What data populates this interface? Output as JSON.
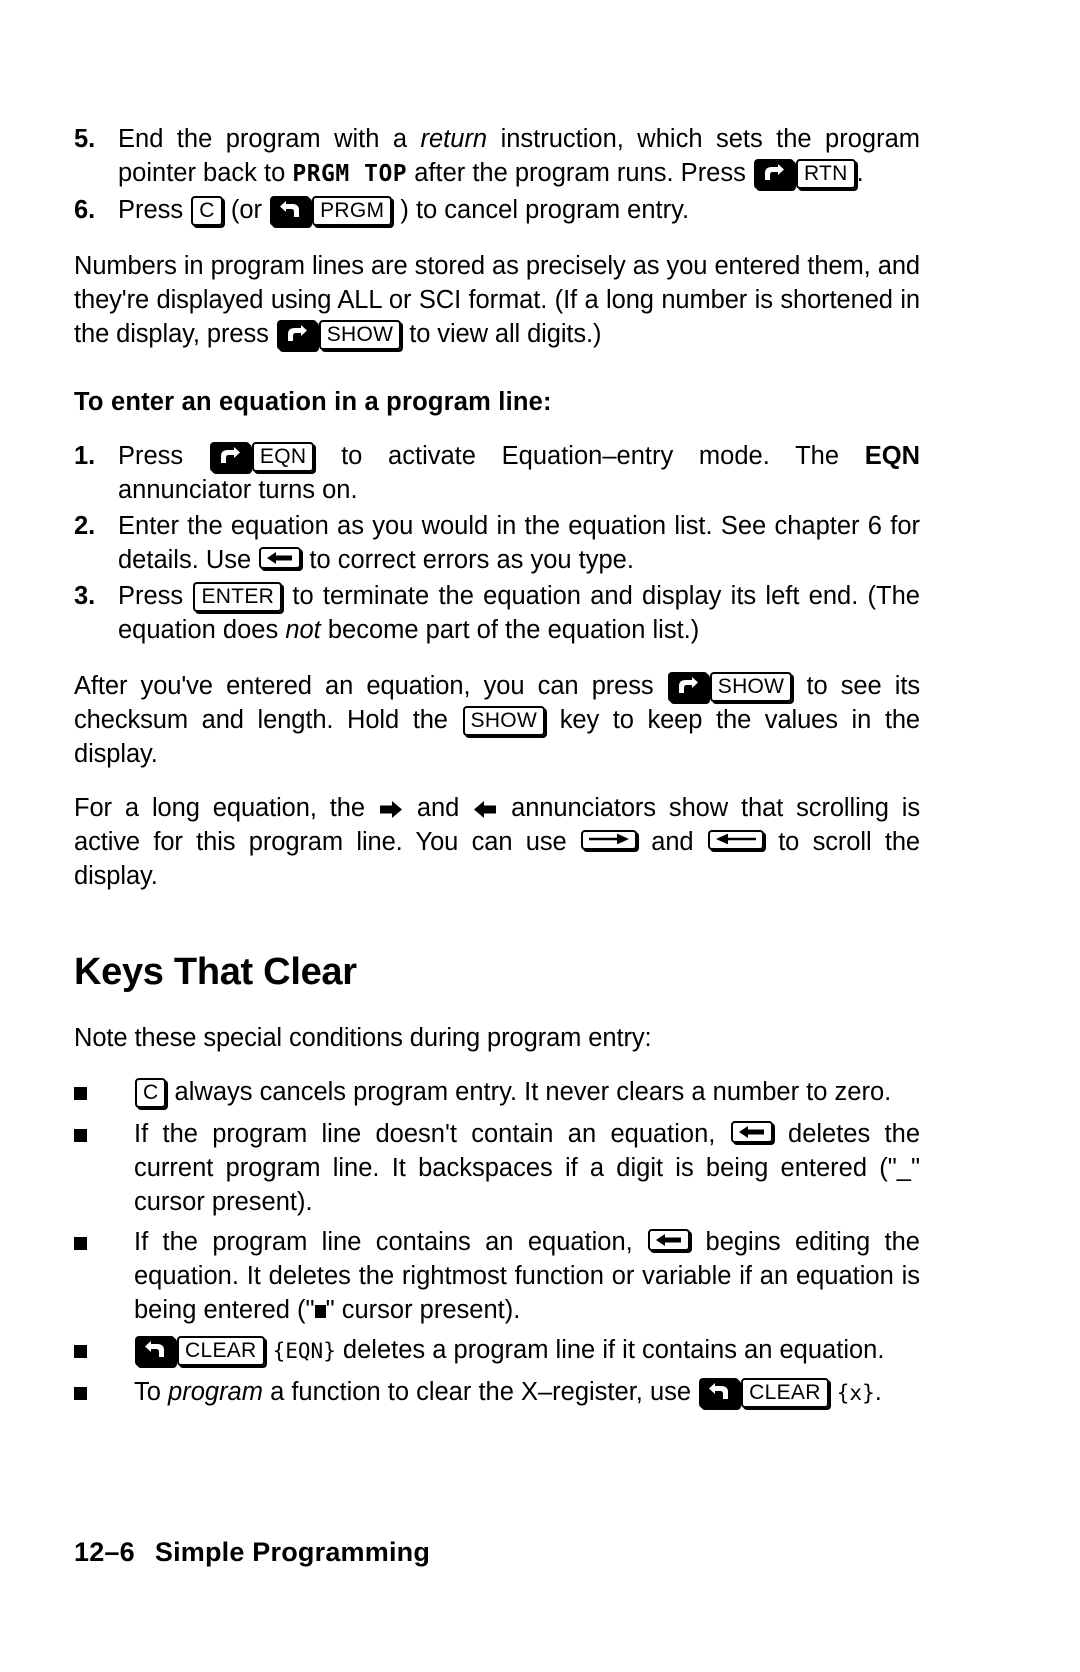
{
  "page": {
    "footer_page_number": "12–6",
    "footer_title": "Simple Programming"
  },
  "steps_continued": [
    {
      "number": "5.",
      "text_1": "End the program with a ",
      "italic_1": "return",
      "text_2": " instruction, which sets the program pointer back to ",
      "lcd_1": "PRGM TOP",
      "text_3": " after the program runs. Press ",
      "key_shift_right": "right-shift",
      "key_1": "RTN",
      "text_4": "."
    },
    {
      "number": "6.",
      "text_1": "Press ",
      "key_1": "C",
      "text_2": " (or ",
      "key_shift_left": "left-shift",
      "key_2": "PRGM",
      "text_3": " ) to cancel program entry."
    }
  ],
  "paragraph_numbers": {
    "text_1": "Numbers in program lines are stored as precisely as you entered them, and they're displayed using ALL or SCI format. (If a long number is shortened in the display, press ",
    "key_shift_right": "right-shift",
    "key_1": "SHOW",
    "text_2": " to view all digits.)"
  },
  "subheading": {
    "label": "To enter an equation in a program line:"
  },
  "equation_steps": [
    {
      "number": "1.",
      "text_1": "Press ",
      "key_shift_right": "right-shift",
      "key_1": "EQN",
      "text_2": " to activate Equation–entry mode. The ",
      "bold_1": "EQN",
      "text_3": " annunciator turns on."
    },
    {
      "number": "2.",
      "text_1": "Enter the equation as you would in the equation list. See chapter 6 for details. Use ",
      "key_backspace": "backspace",
      "text_2": " to correct errors as you type."
    },
    {
      "number": "3.",
      "text_1": "Press ",
      "key_1": "ENTER",
      "text_2": " to terminate the equation and display its left end. (The equation does ",
      "italic_1": "not",
      "text_3": " become part of the equation list.)"
    }
  ],
  "paragraph_checksum": {
    "text_1": "After you've entered an equation, you can press ",
    "key_shift_right": "right-shift",
    "key_1": "SHOW",
    "text_2": " to see its checksum and length. Hold the ",
    "key_2": "SHOW",
    "text_3": " key to keep the values in the display."
  },
  "paragraph_scrolling": {
    "text_1": "For a long equation, the ",
    "annunciator_right": "right-arrow-annunciator",
    "text_2": " and ",
    "annunciator_left": "left-arrow-annunciator",
    "text_3": " annunciators show that scrolling is active for this program line. You can use ",
    "key_right_arrow": "right-arrow",
    "text_4": " and ",
    "key_left_arrow": "left-arrow",
    "text_5": " to scroll the display."
  },
  "section_heading": {
    "label": "Keys That Clear"
  },
  "paragraph_note": {
    "text": "Note these special conditions during program entry:"
  },
  "clear_bullets": [
    {
      "key_1": "C",
      "text_1": " always cancels program entry. It never clears a number to zero."
    },
    {
      "text_1": "If the program line doesn't contain an equation, ",
      "key_backspace": "backspace",
      "text_2": " deletes the current program line. It backspaces if a digit is being entered (\"",
      "cursor_1": "_",
      "text_3": "\" cursor present)."
    },
    {
      "text_1": "If the program line contains an equation, ",
      "key_backspace": "backspace",
      "text_2": " begins editing the equation. It deletes the rightmost function or variable if an equation is being entered (\"",
      "cursor_block": "block-cursor",
      "text_3": "\" cursor present)."
    },
    {
      "key_shift_left": "left-shift",
      "key_1": "CLEAR",
      "menu_1": "{EQN}",
      "text_1": " deletes a program line if it contains an equation."
    },
    {
      "text_1": "To ",
      "italic_1": "program",
      "text_2": " a function to clear the X–register, use ",
      "key_shift_left": "left-shift",
      "key_1": "CLEAR",
      "menu_1": "{x}",
      "text_3": "."
    }
  ],
  "colors": {
    "ink": "#000000",
    "paper": "#ffffff"
  }
}
